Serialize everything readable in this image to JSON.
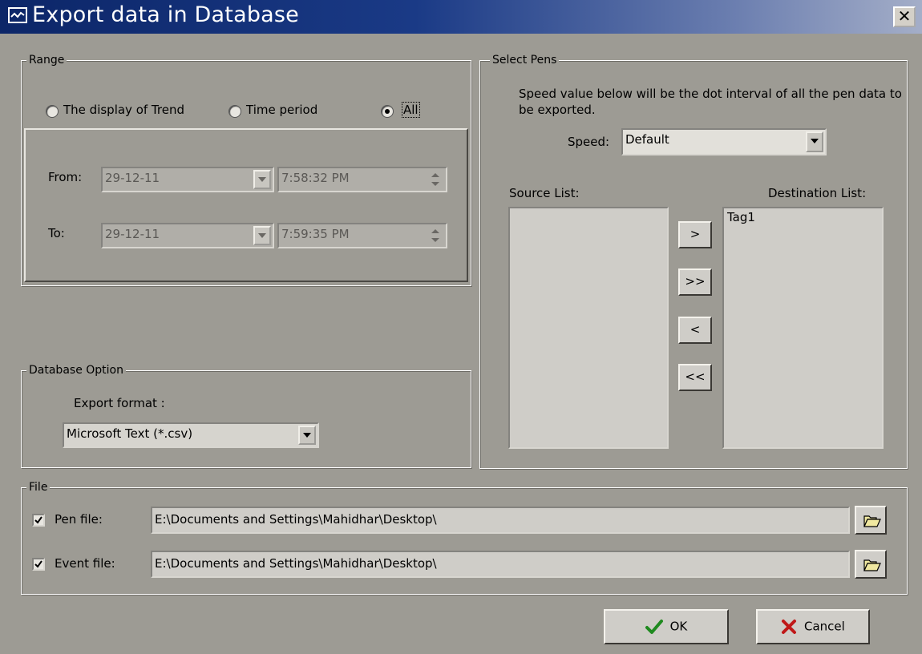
{
  "window": {
    "title": "Export data in Database",
    "close_label": "✕"
  },
  "range": {
    "legend": "Range",
    "options": [
      "The display of Trend",
      "Time period",
      "All"
    ],
    "selected": "All",
    "from_label": "From:",
    "to_label": "To:",
    "from_date": "29-12-11",
    "from_time": "7:58:32 PM",
    "to_date": "29-12-11",
    "to_time": "7:59:35 PM"
  },
  "select_pens": {
    "legend": "Select Pens",
    "description": "Speed value below will be the dot interval of all the pen data to be exported.",
    "speed_label": "Speed:",
    "speed_value": "Default",
    "source_label": "Source List:",
    "destination_label": "Destination List:",
    "source_items": [],
    "destination_items": [
      "Tag1"
    ],
    "buttons": {
      "add": ">",
      "add_all": ">>",
      "remove": "<",
      "remove_all": "<<"
    }
  },
  "database_option": {
    "legend": "Database Option",
    "export_format_label": "Export format :",
    "export_format_value": "Microsoft Text (*.csv)"
  },
  "file": {
    "legend": "File",
    "pen_file_label": "Pen file:",
    "pen_file_checked": true,
    "pen_file_path": "E:\\Documents and Settings\\Mahidhar\\Desktop\\",
    "event_file_label": "Event file:",
    "event_file_checked": true,
    "event_file_path": "E:\\Documents and Settings\\Mahidhar\\Desktop\\"
  },
  "actions": {
    "ok_label": "OK",
    "cancel_label": "Cancel"
  },
  "colors": {
    "dialog_bg": "#9d9b94",
    "title_dark": "#0c2668",
    "ok_check": "#1f8a1f",
    "cancel_x": "#c01818"
  }
}
